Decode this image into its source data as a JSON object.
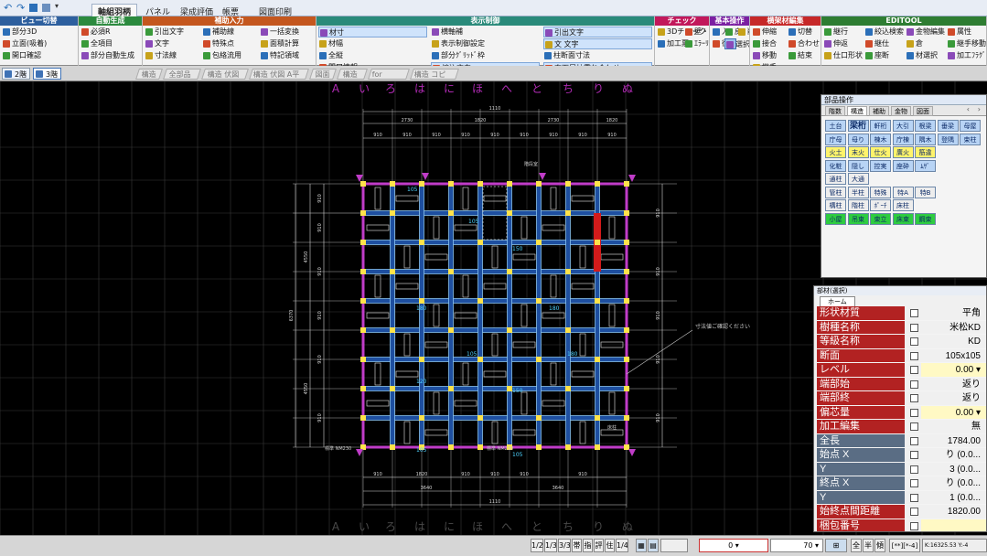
{
  "ribbon_tabs": [
    "軸組羽柄",
    "パネル",
    "梁成評価",
    "帳票",
    "図面印刷"
  ],
  "ribbon_groups": [
    {
      "title": "ビュー切替",
      "color": "#2d5f9e",
      "items": [
        "部分3D",
        "立面(吸着)",
        "開口確認"
      ]
    },
    {
      "title": "自動生成",
      "color": "#2b8a3e",
      "items": [
        "必須R",
        "全項目",
        "部分自動生成"
      ]
    },
    {
      "title": "補助入力",
      "color": "#c4571e",
      "items": [
        "引出文字",
        "文字",
        "寸法線",
        "補助線",
        "特殊点",
        "包絡流用",
        "一括変換",
        "面積計算",
        "特記領域"
      ]
    },
    {
      "title": "表示制御",
      "color": "#2a8a7a",
      "items": [
        "材寸",
        "材幅",
        "全縦",
        "開口情報",
        "寸法線",
        "横軸補",
        "表示制御設定",
        "部分ｸﾞﾘｯﾄﾞ枠",
        "編込方向",
        "全ﾚﾍﾞﾙ編集",
        "引出文字",
        "文 文字",
        "柱断面寸法",
        "直下屋柱重ね合わせ",
        "直下屋垂ね合わせ"
      ]
    },
    {
      "title": "チェック",
      "color": "#c2185b",
      "items": [
        "3Dチェック",
        "加工票",
        "壁・間",
        "ｴﾗｰﾘｽﾄ"
      ]
    },
    {
      "title": "基本操作",
      "color": "#7b1fa2",
      "items": [
        "入",
        "復",
        "戻",
        "選択",
        "削除"
      ]
    },
    {
      "title": "横架材編集",
      "color": "#c62828",
      "items": [
        "伸縮",
        "接合",
        "移動",
        "継手",
        "切替",
        "合わせ",
        "結束"
      ]
    },
    {
      "title": "EDITOOL",
      "color": "#2e7d32",
      "items": [
        "継行",
        "伸返",
        "仕口形状",
        "絞込検索",
        "継仕",
        "座断",
        "金物編集",
        "倉",
        "材選択",
        "属性",
        "継手移動",
        "加工ﾌﾗｸﾞ"
      ]
    }
  ],
  "floors": {
    "f2": "2階",
    "f3": "3階"
  },
  "view_tabs": [
    "構造",
    "全部品",
    "構造 伏図",
    "構造 伏図 A平付",
    "図面",
    "構造",
    "for check",
    "構造 コピー"
  ],
  "axis_labels": [
    "A",
    "い",
    "ろ",
    "は",
    "に",
    "ほ",
    "へ",
    "と",
    "ち",
    "り",
    "ぬ"
  ],
  "dims": {
    "top_total": "1110",
    "top_sub": [
      "2730",
      "1820",
      "2730",
      "1820"
    ],
    "top_each": [
      "910",
      "910",
      "910",
      "910",
      "910",
      "910",
      "910",
      "910",
      "910",
      "910"
    ],
    "bottom_each": [
      "910",
      "1820",
      "910",
      "910",
      "910",
      "910"
    ],
    "bottom_sub": [
      "3640",
      "3640"
    ],
    "bottom_total": "1110",
    "left": [
      "910",
      "910",
      "910",
      "910",
      "910",
      "910"
    ],
    "left_sub": [
      "4550",
      "4550"
    ],
    "left_total": "6370",
    "right": [
      "910",
      "910",
      "910",
      "910",
      "910"
    ]
  },
  "plan_labels": {
    "beam": "105",
    "beam2": "150",
    "beam3": "180",
    "beam4": "120",
    "note": "寸法値ご確認ください",
    "dim_lbl": "標準 NM230",
    "pointer": "階段室",
    "kaidan": "床柱"
  },
  "parts_panel": {
    "title": "部品操作",
    "tabs": [
      "階数",
      "構造",
      "補助",
      "金物",
      "図面"
    ],
    "rows": [
      [
        {
          "t": "土台",
          "c": "#b8d4f5"
        },
        {
          "t": "梁桁",
          "c": "#b8d4f5",
          "bold": true
        },
        {
          "t": "軒桁",
          "c": "#b8d4f5"
        },
        {
          "t": "大引",
          "c": "#b8d4f5"
        },
        {
          "t": "根梁",
          "c": "#b8d4f5"
        },
        {
          "t": "垂梁",
          "c": "#b8d4f5"
        },
        {
          "t": "母屋",
          "c": "#b8d4f5"
        }
      ],
      [
        {
          "t": "庁母",
          "c": "#b8d4f5"
        },
        {
          "t": "母り",
          "c": "#b8d4f5"
        },
        {
          "t": "棟木",
          "c": "#b8d4f5"
        },
        {
          "t": "庁棟",
          "c": "#b8d4f5"
        },
        {
          "t": "隅木",
          "c": "#b8d4f5"
        },
        {
          "t": "登隅",
          "c": "#b8d4f5"
        },
        {
          "t": "束柱",
          "c": "#b8d4f5"
        }
      ],
      [
        {
          "t": "火土",
          "c": "#fff36b"
        },
        {
          "t": "末火",
          "c": "#fff36b"
        },
        {
          "t": "仕火",
          "c": "#fff36b"
        },
        {
          "t": "廣火",
          "c": "#fff36b"
        },
        {
          "t": "筋違",
          "c": "#fff36b"
        }
      ],
      [
        {
          "t": "化粧",
          "c": "#b8d4f5"
        },
        {
          "t": "隠し",
          "c": "#b8d4f5"
        },
        {
          "t": "控実",
          "c": "#b8d4f5"
        },
        {
          "t": "座砕",
          "c": "#b8d4f5"
        },
        {
          "t": "ﾑｻﾞ",
          "c": "#b8d4f5"
        }
      ],
      [
        {
          "t": "通柱",
          "c": "#ededed"
        },
        {
          "t": "大通",
          "c": "#ededed"
        }
      ],
      [
        {
          "t": "管柱",
          "c": "#ededed"
        },
        {
          "t": "半柱",
          "c": "#ededed"
        },
        {
          "t": "特殊",
          "c": "#ededed"
        },
        {
          "t": "特A",
          "c": "#ededed"
        },
        {
          "t": "特B",
          "c": "#ededed"
        }
      ],
      [
        {
          "t": "構柱",
          "c": "#ededed"
        },
        {
          "t": "階柱",
          "c": "#ededed"
        },
        {
          "t": "ﾎﾟｰﾁ",
          "c": "#ededed"
        },
        {
          "t": "床柱",
          "c": "#ededed"
        }
      ],
      [
        {
          "t": "小屋",
          "c": "#2ecc40"
        },
        {
          "t": "吊束",
          "c": "#2ecc40"
        },
        {
          "t": "束立",
          "c": "#2ecc40"
        },
        {
          "t": "床束",
          "c": "#2ecc40"
        },
        {
          "t": "鋼束",
          "c": "#2ecc40"
        }
      ]
    ]
  },
  "prop_panel": {
    "title": "部材(選択)",
    "home_tab": "ホーム",
    "rows": [
      {
        "label": "形状材質",
        "value": "平角",
        "lc": "#b22222",
        "vc": "#f0f0f0"
      },
      {
        "label": "樹種名称",
        "value": "米松KD",
        "lc": "#b22222",
        "vc": "#f0f0f0"
      },
      {
        "label": "等級名称",
        "value": "KD",
        "lc": "#b22222",
        "vc": "#f0f0f0"
      },
      {
        "label": "断面",
        "value": "105x105",
        "lc": "#b22222",
        "vc": "#f0f0f0"
      },
      {
        "label": "レベル",
        "value": "0.00 ▾",
        "lc": "#b22222",
        "vc": "#fff9c4"
      },
      {
        "label": "端部始",
        "value": "返り",
        "lc": "#b22222",
        "vc": "#f0f0f0"
      },
      {
        "label": "端部終",
        "value": "返り",
        "lc": "#b22222",
        "vc": "#f0f0f0"
      },
      {
        "label": "偏芯量",
        "value": "0.00 ▾",
        "lc": "#b22222",
        "vc": "#fff9c4"
      },
      {
        "label": "加工編集",
        "value": "無",
        "lc": "#b22222",
        "vc": "#f0f0f0"
      },
      {
        "label": "全長",
        "value": "1784.00",
        "lc": "#5a6d84",
        "vc": "#f0f0f0"
      },
      {
        "label": "始点  X",
        "value": "り (0.0...",
        "lc": "#5a6d84",
        "vc": "#f0f0f0"
      },
      {
        "label": "      Y",
        "value": "3 (0.0...",
        "lc": "#5a6d84",
        "vc": "#f0f0f0"
      },
      {
        "label": "終点  X",
        "value": "り (0.0...",
        "lc": "#5a6d84",
        "vc": "#f0f0f0"
      },
      {
        "label": "      Y",
        "value": "1 (0.0...",
        "lc": "#5a6d84",
        "vc": "#f0f0f0"
      },
      {
        "label": "始終点間距離",
        "value": "1820.00",
        "lc": "#b22222",
        "vc": "#f0f0f0"
      },
      {
        "label": "梱包番号",
        "value": "",
        "lc": "#b22222",
        "vc": "#fff9c4"
      }
    ]
  },
  "status": {
    "pages": [
      "1/2",
      "1/3",
      "3/3",
      "帯",
      "指",
      "評",
      "住",
      "1/4"
    ],
    "selector_val": "0",
    "zoom": "70",
    "coords": "K:16325.53 Y:-4",
    "misc": "[**][*-4]",
    "btns": [
      "全",
      "半",
      "傾"
    ]
  },
  "colors": {
    "beam_fill": "#1e4fa0",
    "beam_edge": "#9ad6ff",
    "red_beam": "#d31b1b",
    "magenta": "#c03cc8",
    "yellow_post": "#ffe34a",
    "dim_line": "#d8d8d8",
    "axis_magenta": "#b12bb5",
    "grid": "#3a3a3a"
  }
}
